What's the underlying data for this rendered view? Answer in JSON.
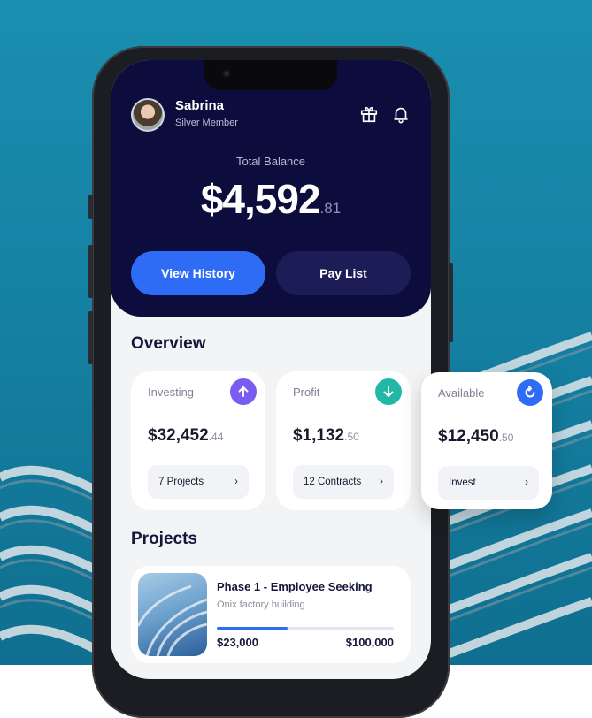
{
  "user": {
    "name": "Sabrina",
    "tier": "Silver Member"
  },
  "balance": {
    "label": "Total Balance",
    "amount": "$4,592",
    "cents": ".81"
  },
  "actions": {
    "view_history": "View History",
    "pay_list": "Pay List"
  },
  "overview": {
    "title": "Overview",
    "cards": [
      {
        "label": "Investing",
        "amount": "$32,452",
        "cents": ".44",
        "pill": "7 Projects",
        "icon": "arrow-up-icon",
        "color": "#7b5cf0"
      },
      {
        "label": "Profit",
        "amount": "$1,132",
        "cents": ".50",
        "pill": "12 Contracts",
        "icon": "arrow-down-icon",
        "color": "#22b8a6"
      },
      {
        "label": "Available",
        "amount": "$12,450",
        "cents": ".50",
        "pill": "Invest",
        "icon": "refresh-icon",
        "color": "#2f6cf6"
      }
    ]
  },
  "projects": {
    "title": "Projects",
    "items": [
      {
        "title": "Phase 1 - Employee Seeking",
        "subtitle": "Onix factory building",
        "raised": "$23,000",
        "goal": "$100,000",
        "progress": 0.4
      }
    ]
  },
  "colors": {
    "header": "#0d0d3d",
    "accent": "#2f6cf6",
    "secondary_button": "#1c1c56"
  }
}
